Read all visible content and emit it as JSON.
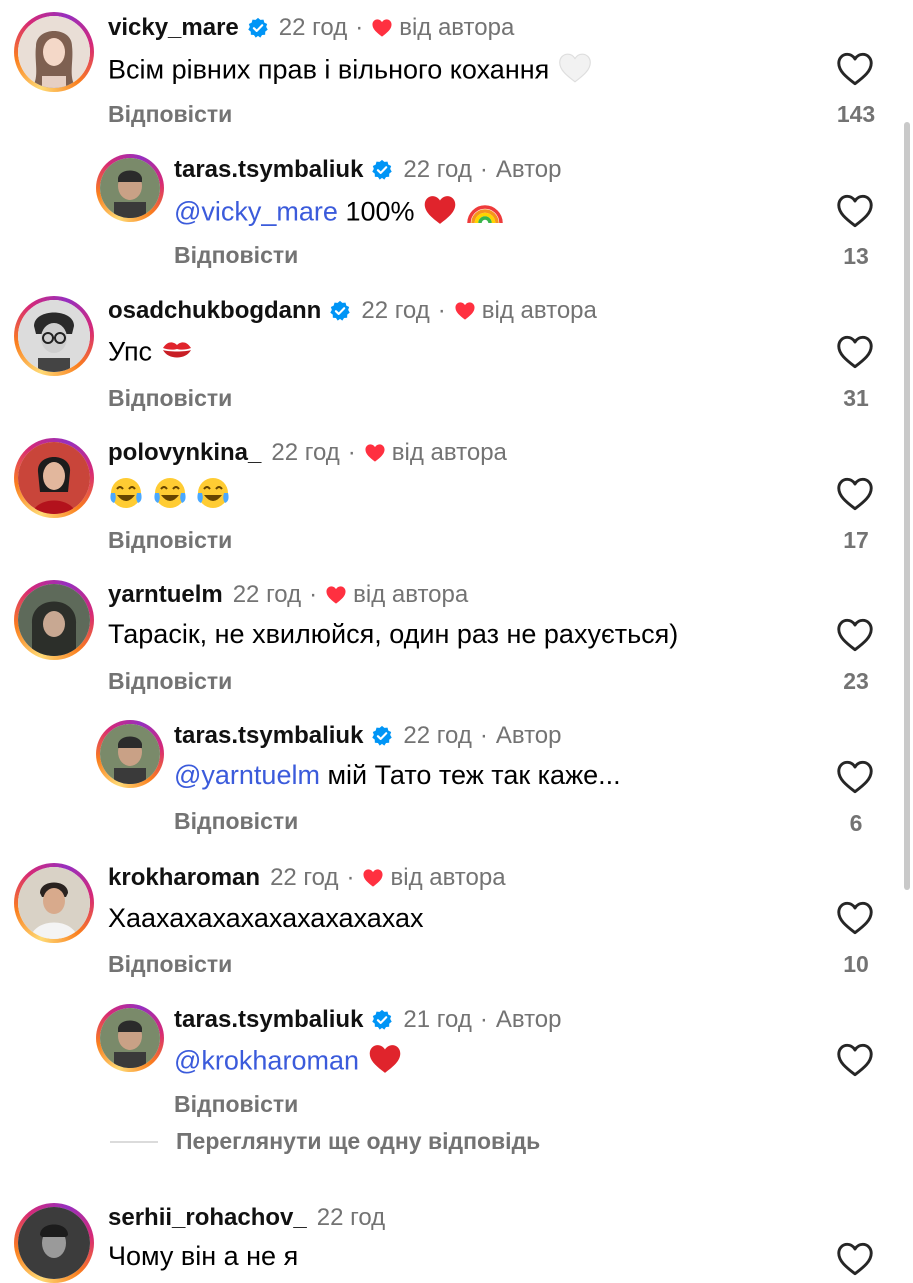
{
  "comments": [
    {
      "username": "vicky_mare",
      "verified": true,
      "time": "22 год",
      "author_liked": "від автора",
      "text": "Всім рівних прав і вільного кохання",
      "reply_label": "Відповісти",
      "likes": "143"
    },
    {
      "username": "taras.tsymbaliuk",
      "verified": true,
      "time": "22 год",
      "author_tag": "Автор",
      "mention": "@vicky_mare",
      "text": "100%",
      "reply_label": "Відповісти",
      "likes": "13"
    },
    {
      "username": "osadchukbogdann",
      "verified": true,
      "time": "22 год",
      "author_liked": "від автора",
      "text": "Упс",
      "reply_label": "Відповісти",
      "likes": "31"
    },
    {
      "username": "polovynkina_",
      "verified": false,
      "time": "22 год",
      "author_liked": "від автора",
      "text": "",
      "reply_label": "Відповісти",
      "likes": "17"
    },
    {
      "username": "yarntuelm",
      "verified": false,
      "time": "22 год",
      "author_liked": "від автора",
      "text": "Тарасік, не хвилюйся, один раз не рахується)",
      "reply_label": "Відповісти",
      "likes": "23"
    },
    {
      "username": "taras.tsymbaliuk",
      "verified": true,
      "time": "22 год",
      "author_tag": "Автор",
      "mention": "@yarntuelm",
      "text": "мій Тато теж так каже...",
      "reply_label": "Відповісти",
      "likes": "6"
    },
    {
      "username": "krokharoman",
      "verified": false,
      "time": "22 год",
      "author_liked": "від автора",
      "text": "Хаахахахахахахахахахах",
      "reply_label": "Відповісти",
      "likes": "10"
    },
    {
      "username": "taras.tsymbaliuk",
      "verified": true,
      "time": "21 год",
      "author_tag": "Автор",
      "mention": "@krokharoman",
      "text": "",
      "reply_label": "Відповісти",
      "likes": ""
    },
    {
      "username": "serhii_rohachov_",
      "verified": false,
      "time": "22 год",
      "text": "Чому він а не я"
    }
  ],
  "view_more_replies": "Переглянути ще одну відповідь",
  "colors": {
    "verified": "#0095f6",
    "heart": "#ff3040",
    "mention": "#3b5bdb",
    "secondary": "#737373"
  },
  "icons": {
    "like": "heart-outline-icon",
    "verified": "verified-badge-icon",
    "liked_by_author": "heart-filled-icon"
  }
}
